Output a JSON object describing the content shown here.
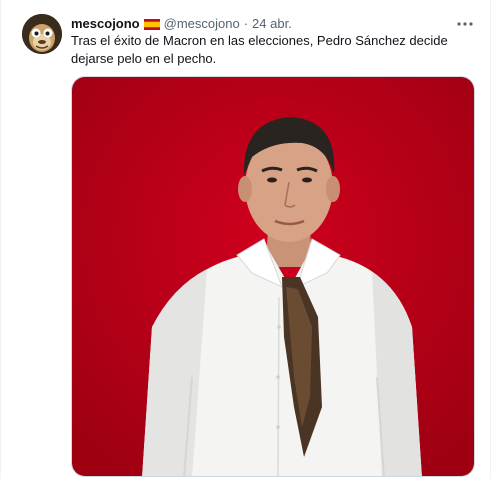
{
  "tweet": {
    "author_name": "mescojono",
    "author_flag": "spain-flag-icon",
    "author_handle": "@mescojono",
    "separator": "·",
    "date": "24 abr.",
    "text": "Tras el éxito de Macron en las elecciones, Pedro Sánchez decide dejarse pelo en el pecho.",
    "more_icon": "more-horizontal-icon",
    "media": {
      "kind": "photo",
      "background_color": "#c4001a"
    }
  },
  "colors": {
    "name": "#0f1419",
    "secondary": "#536471",
    "border": "#cfd9de",
    "photo_red": "#c4001a"
  }
}
